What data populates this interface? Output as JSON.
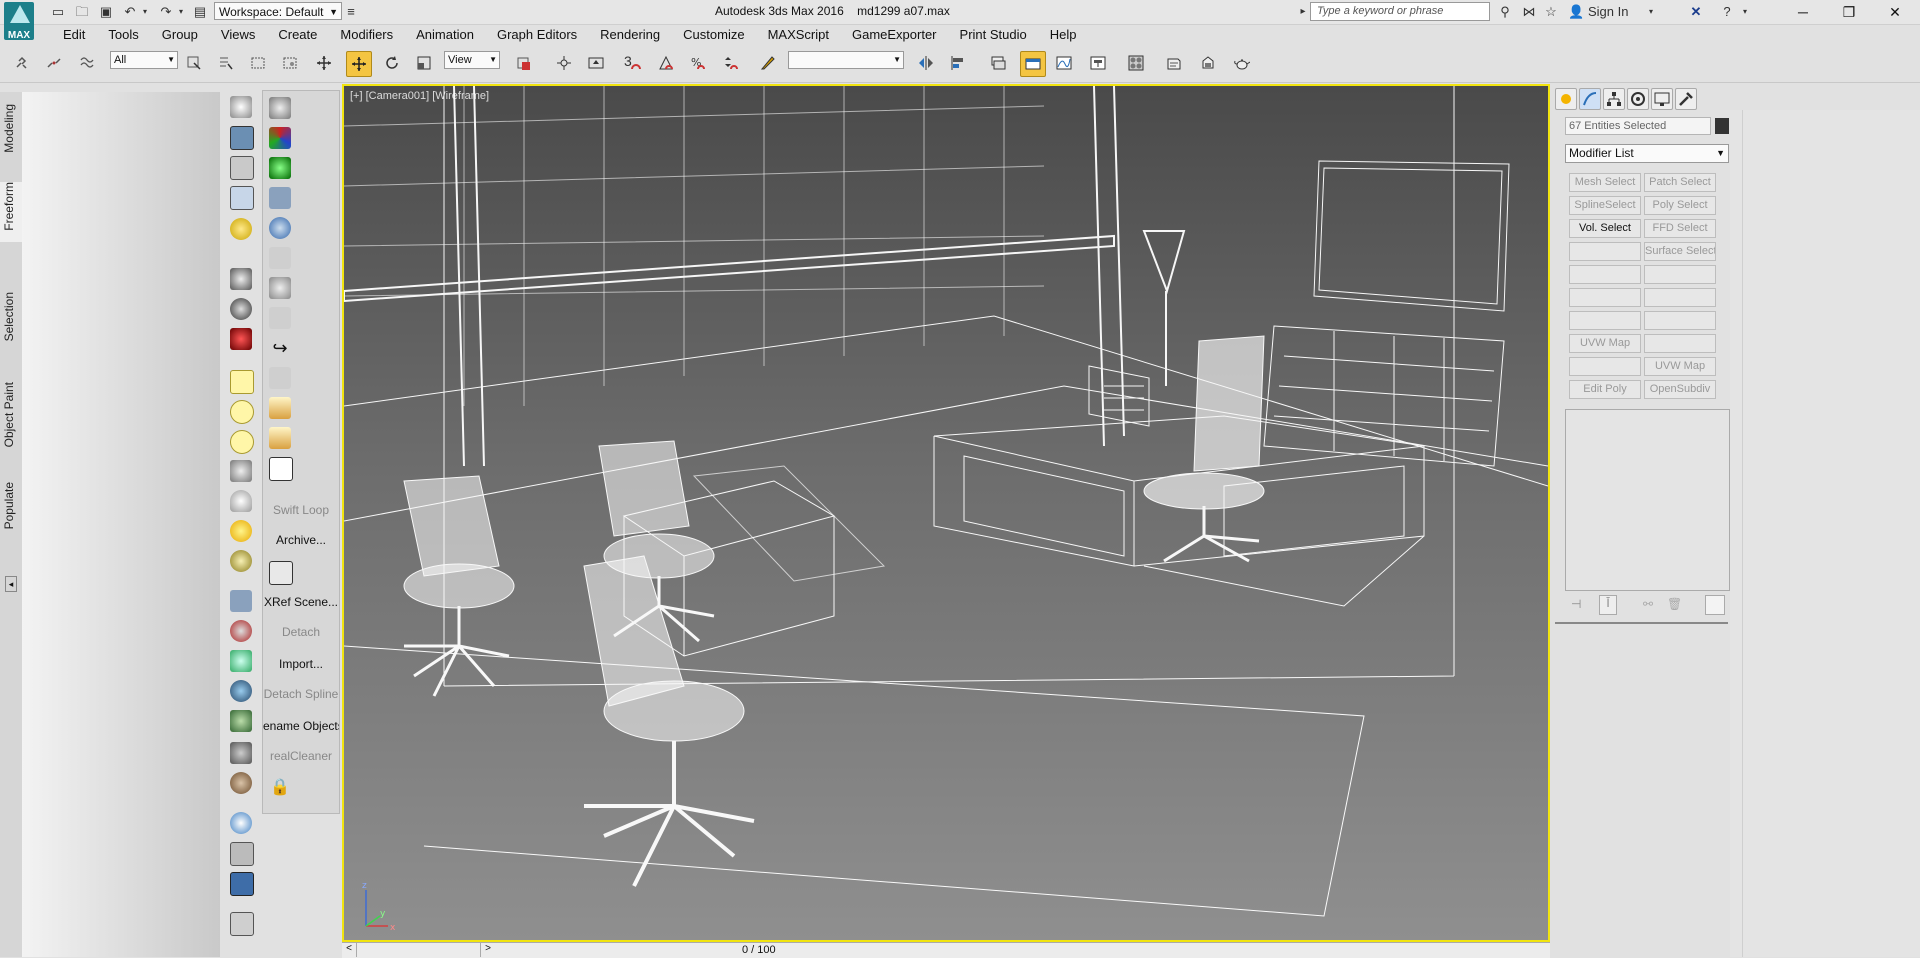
{
  "titlebar": {
    "workspace_label": "Workspace: Default",
    "app_title": "Autodesk 3ds Max 2016",
    "file_name": "md1299 a07.max",
    "search_placeholder": "Type a keyword or phrase",
    "sign_in": "Sign In",
    "logo_text": "MAX"
  },
  "menubar": {
    "items": [
      "Edit",
      "Tools",
      "Group",
      "Views",
      "Create",
      "Modifiers",
      "Animation",
      "Graph Editors",
      "Rendering",
      "Customize",
      "MAXScript",
      "GameExporter",
      "Print Studio",
      "Help"
    ]
  },
  "toolbar": {
    "selection_filter": "All",
    "ref_coord": "View",
    "snap_number": "3",
    "named_selection": ""
  },
  "left_tabs": [
    "Modeling",
    "Freeform",
    "Selection",
    "Object Paint",
    "Populate"
  ],
  "scripts_panel": {
    "labels": [
      {
        "text": "Swift Loop",
        "enabled": false
      },
      {
        "text": "Archive...",
        "enabled": true
      },
      {
        "text": "XRef Scene...",
        "enabled": true
      },
      {
        "text": "Detach",
        "enabled": false
      },
      {
        "text": "Import...",
        "enabled": true
      },
      {
        "text": "Detach Spline",
        "enabled": false
      },
      {
        "text": "ename Objects",
        "enabled": true
      },
      {
        "text": "realCleaner",
        "enabled": false
      }
    ]
  },
  "viewport": {
    "label": "[+] [Camera001] [Wireframe]",
    "axis_x": "x",
    "axis_y": "y",
    "axis_z": "z"
  },
  "timeline": {
    "frame_label": "0 / 100",
    "prev": "<",
    "next": ">"
  },
  "command_panel": {
    "selection_info": "67 Entities Selected",
    "modifier_list": "Modifier List",
    "buttons": [
      {
        "text": "Mesh Select",
        "enabled": false
      },
      {
        "text": "Patch Select",
        "enabled": false
      },
      {
        "text": "SplineSelect",
        "enabled": false
      },
      {
        "text": "Poly Select",
        "enabled": false
      },
      {
        "text": "Vol. Select",
        "enabled": true
      },
      {
        "text": "FFD Select",
        "enabled": false
      },
      {
        "text": "",
        "enabled": false
      },
      {
        "text": "Surface Select",
        "enabled": false
      },
      {
        "text": "",
        "enabled": false
      },
      {
        "text": "",
        "enabled": false
      },
      {
        "text": "",
        "enabled": false
      },
      {
        "text": "",
        "enabled": false
      },
      {
        "text": "",
        "enabled": false
      },
      {
        "text": "",
        "enabled": false
      },
      {
        "text": "UVW Map",
        "enabled": false
      },
      {
        "text": "",
        "enabled": false
      },
      {
        "text": "",
        "enabled": false
      },
      {
        "text": "UVW Map",
        "enabled": false
      },
      {
        "text": "Edit Poly",
        "enabled": false
      },
      {
        "text": "OpenSubdiv",
        "enabled": false
      }
    ]
  },
  "colors": {
    "accent_viewport_border": "#f1e40f",
    "wire": "#ffffff",
    "brand": "#1d7f8a"
  }
}
